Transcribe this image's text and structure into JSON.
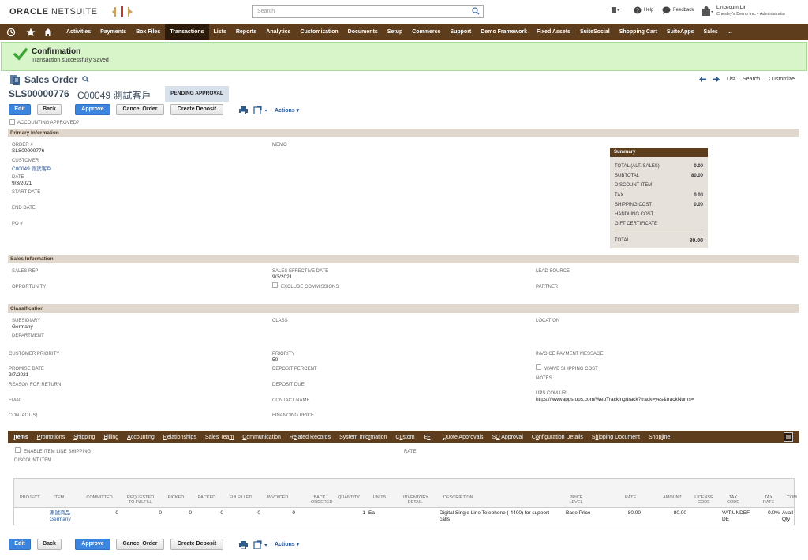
{
  "header": {
    "logo_main": "ORACLE",
    "logo_sub": "NETSUITE",
    "search_placeholder": "Search",
    "help": "Help",
    "feedback": "Feedback",
    "user_name": "Lincecum Lin",
    "user_role": "Chesley's Demo Inc. - Administrator"
  },
  "nav": [
    "Activities",
    "Payments",
    "Box Files",
    "Transactions",
    "Lists",
    "Reports",
    "Analytics",
    "Customization",
    "Documents",
    "Setup",
    "Commerce",
    "Support",
    "Demo Framework",
    "Fixed Assets",
    "SuiteSocial",
    "Shopping Cart",
    "SuiteApps",
    "Sales",
    "..."
  ],
  "nav_active": "Transactions",
  "confirm": {
    "title": "Confirmation",
    "message": "Transaction successfully Saved"
  },
  "page": {
    "title": "Sales Order",
    "number": "SLS00000776",
    "customer": "C00049 測試客戶",
    "status": "PENDING APPROVAL",
    "links": {
      "list": "List",
      "search": "Search",
      "customize": "Customize"
    }
  },
  "buttons": {
    "edit": "Edit",
    "back": "Back",
    "approve": "Approve",
    "cancel": "Cancel Order",
    "deposit": "Create Deposit",
    "actions": "Actions"
  },
  "accounting_approved": "ACCOUNTING APPROVED?",
  "primary": {
    "header": "Primary Information",
    "order_lbl": "ORDER #",
    "order_val": "SLS00000776",
    "customer_lbl": "CUSTOMER",
    "customer_val": "C00049 測試客戶",
    "date_lbl": "DATE",
    "date_val": "9/3/2021",
    "start_lbl": "START DATE",
    "end_lbl": "END DATE",
    "po_lbl": "PO #",
    "memo_lbl": "MEMO"
  },
  "summary": {
    "title": "Summary",
    "rows": [
      {
        "label": "TOTAL (ALT. SALES)",
        "value": "0.00"
      },
      {
        "label": "SUBTOTAL",
        "value": "80.00"
      },
      {
        "label": "DISCOUNT ITEM",
        "value": ""
      },
      {
        "label": "TAX",
        "value": "0.00"
      },
      {
        "label": "SHIPPING COST",
        "value": "0.00"
      },
      {
        "label": "HANDLING COST",
        "value": ""
      },
      {
        "label": "GIFT CERTIFICATE",
        "value": ""
      }
    ],
    "total_label": "TOTAL",
    "total_value": "80.00"
  },
  "sales": {
    "header": "Sales Information",
    "rep": "SALES REP",
    "eff_lbl": "SALES EFFECTIVE DATE",
    "eff_val": "9/3/2021",
    "lead": "LEAD SOURCE",
    "opp": "OPPORTUNITY",
    "excl": "EXCLUDE COMMISSIONS",
    "partner": "PARTNER"
  },
  "classification": {
    "header": "Classification",
    "sub_lbl": "SUBSIDIARY",
    "sub_val": "Germany",
    "class": "CLASS",
    "location": "LOCATION",
    "dept": "DEPARTMENT"
  },
  "misc": {
    "cust_priority": "CUSTOMER PRIORITY",
    "priority_lbl": "PRIORITY",
    "priority_val": "50",
    "inv_msg": "INVOICE PAYMENT MESSAGE",
    "promise_lbl": "PROMISE DATE",
    "promise_val": "9/7/2021",
    "deposit_pct": "DEPOSIT PERCENT",
    "waive": "WAIVE SHIPPING COST",
    "notes": "NOTES",
    "return": "REASON FOR RETURN",
    "deposit_due": "DEPOSIT DUE",
    "ups_lbl": "UPS.COM URL",
    "ups_val": "https://wwwapps.ups.com/WebTracking/track?track=yes&trackNums=",
    "email": "EMAIL",
    "contact_name": "CONTACT NAME",
    "contacts": "CONTACT(S)",
    "financing": "FINANCING PRICE"
  },
  "subtabs": [
    {
      "pre": "",
      "u": "I",
      "post": "tems"
    },
    {
      "pre": "",
      "u": "P",
      "post": "romotions"
    },
    {
      "pre": "",
      "u": "S",
      "post": "hipping"
    },
    {
      "pre": "",
      "u": "B",
      "post": "illing"
    },
    {
      "pre": "",
      "u": "A",
      "post": "ccounting"
    },
    {
      "pre": "",
      "u": "R",
      "post": "elationships"
    },
    {
      "pre": "Sales Tea",
      "u": "m",
      "post": ""
    },
    {
      "pre": "",
      "u": "C",
      "post": "ommunication"
    },
    {
      "pre": "R",
      "u": "e",
      "post": "lated Records"
    },
    {
      "pre": "System Info",
      "u": "r",
      "post": "mation"
    },
    {
      "pre": "C",
      "u": "u",
      "post": "stom"
    },
    {
      "pre": "E",
      "u": "F",
      "post": "T"
    },
    {
      "pre": "",
      "u": "Q",
      "post": "uote Approvals"
    },
    {
      "pre": "S",
      "u": "O",
      "post": " Approval"
    },
    {
      "pre": "C",
      "u": "o",
      "post": "nfiguration Details"
    },
    {
      "pre": "S",
      "u": "h",
      "post": "ipping Document"
    },
    {
      "pre": "Shop",
      "u": "l",
      "post": "ine"
    }
  ],
  "items": {
    "enable_shipping": "ENABLE ITEM LINE SHIPPING",
    "rate": "RATE",
    "discount": "DISCOUNT ITEM",
    "columns": [
      "PROJECT",
      "ITEM",
      "COMMITTED",
      "REQUESTED TO FULFILL",
      "PICKED",
      "PACKED",
      "FULFILLED",
      "INVOICED",
      "BACK ORDERED",
      "QUANTITY",
      "UNITS",
      "INVENTORY DETAIL",
      "DESCRIPTION",
      "PRICE LEVEL",
      "RATE",
      "AMOUNT",
      "LICENSE CODE",
      "TAX CODE",
      "TAX RATE",
      "COM"
    ],
    "row": {
      "item": "測試商品 - Germany",
      "committed": "0",
      "requested": "0",
      "picked": "0",
      "packed": "0",
      "fulfilled": "0",
      "invoiced": "0",
      "quantity": "1",
      "units": "Ea",
      "description": "Digital Single Line Telephone ( 4400) for support calls",
      "price_level": "Base Price",
      "rate": "80.00",
      "amount": "80.00",
      "tax_code": "VAT:UNDEF-DE",
      "tax_rate": "0.0%",
      "com": "Avail Qty"
    }
  }
}
